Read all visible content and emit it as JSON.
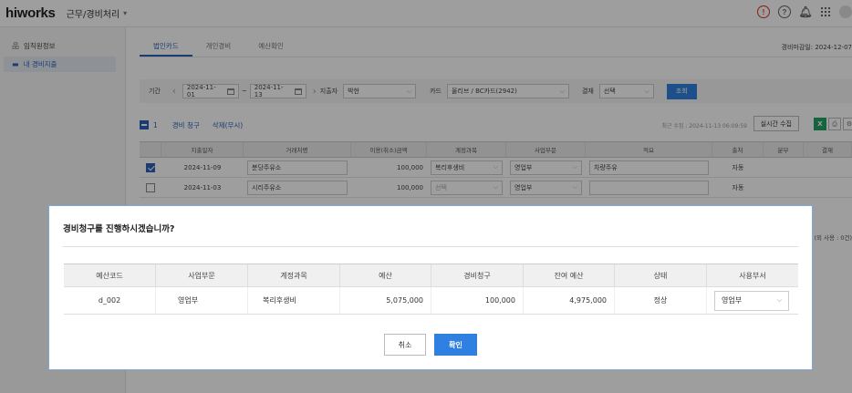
{
  "header": {
    "brand": "hiworks",
    "menu_label": "근무/경비처리",
    "icons": [
      "alert-icon",
      "help-icon",
      "bell-icon",
      "apps-grid-icon",
      "avatar"
    ]
  },
  "sidebar": {
    "items": [
      {
        "label": "임직원정보",
        "icon": "org-icon",
        "active": false
      },
      {
        "label": "내 경비지출",
        "icon": "card-icon",
        "active": true
      }
    ]
  },
  "tabs": [
    {
      "label": "법인카드",
      "active": true
    },
    {
      "label": "개인경비",
      "active": false
    },
    {
      "label": "예산확인",
      "active": false
    }
  ],
  "closing_date": "경비마감일: 2024-12-07",
  "filter": {
    "period_label": "기간",
    "start_date": "2024-11-01",
    "end_date": "2024-11-13",
    "spender_label": "지출자",
    "spender_value": "박현",
    "card_label": "카드",
    "card_value": "올리브 / BC카드(2942)",
    "approval_label": "결재",
    "approval_value": "선택",
    "search_button": "조회"
  },
  "actions": {
    "selected_count": "1",
    "claim_link": "경비 청구",
    "delete_link": "삭제(무시)",
    "recent_collect": "최근 수집 : 2024-11-13 06:09:59",
    "realtime_button": "실시간 수집",
    "excel_icon": "X"
  },
  "list_table": {
    "columns": [
      "지출일자",
      "거래처명",
      "이용(취소)금액",
      "계정과목",
      "사업부문",
      "적요",
      "출처",
      "분부",
      "결재"
    ],
    "rows": [
      {
        "checked": true,
        "date": "2024-11-09",
        "vendor": "분당주유소",
        "amount": "100,000",
        "account": "복리후생비",
        "division": "영업부",
        "memo": "차량주유",
        "source": "자동",
        "split": "",
        "approval": ""
      },
      {
        "checked": false,
        "date": "2024-11-03",
        "vendor": "시리주유소",
        "amount": "100,000",
        "account": "선택",
        "division": "영업부",
        "memo": "",
        "source": "자동",
        "split": "",
        "approval": ""
      }
    ],
    "usage_note": "(외 사용 : 0건)"
  },
  "modal": {
    "title": "경비청구를 진행하시겠습니까?",
    "columns": [
      "예산코드",
      "사업부문",
      "계정과목",
      "예산",
      "경비청구",
      "잔여 예산",
      "상태",
      "사용부서"
    ],
    "row": {
      "code": "d_002",
      "division": "영업부",
      "account": "복리후생비",
      "budget": "5,075,000",
      "claim": "100,000",
      "remaining": "4,975,000",
      "status": "정상",
      "department": "영업부"
    },
    "cancel_button": "취소",
    "confirm_button": "확인"
  }
}
